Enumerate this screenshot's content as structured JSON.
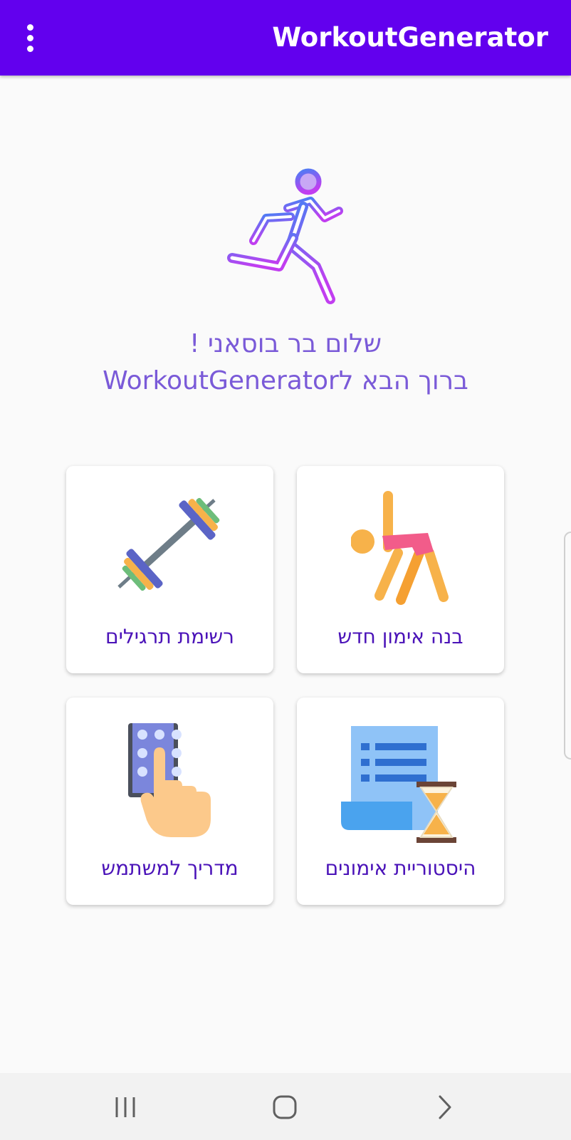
{
  "app_bar": {
    "title": "WorkoutGenerator",
    "overflow_icon": "more-vert-icon",
    "color": "#6200ee"
  },
  "hero": {
    "icon": "running-person-icon",
    "greeting": "שלום בר בוסאני !",
    "welcome": "ברוך הבא לWorkoutGenerator"
  },
  "cards": [
    {
      "label": "בנה אימון חדש",
      "icon": "stretching-person-icon"
    },
    {
      "label": "רשימת תרגילים",
      "icon": "barbell-icon"
    },
    {
      "label": "היסטוריית אימונים",
      "icon": "document-hourglass-icon"
    },
    {
      "label": "מדריך למשתמש",
      "icon": "hand-keypad-icon"
    }
  ],
  "nav_bar": {
    "recents_icon": "recent-apps-icon",
    "home_icon": "home-icon",
    "back_icon": "back-icon"
  },
  "colors": {
    "accent": "#6200ee",
    "text_purple": "#7a5ad8",
    "label_purple": "#4a12b8"
  }
}
